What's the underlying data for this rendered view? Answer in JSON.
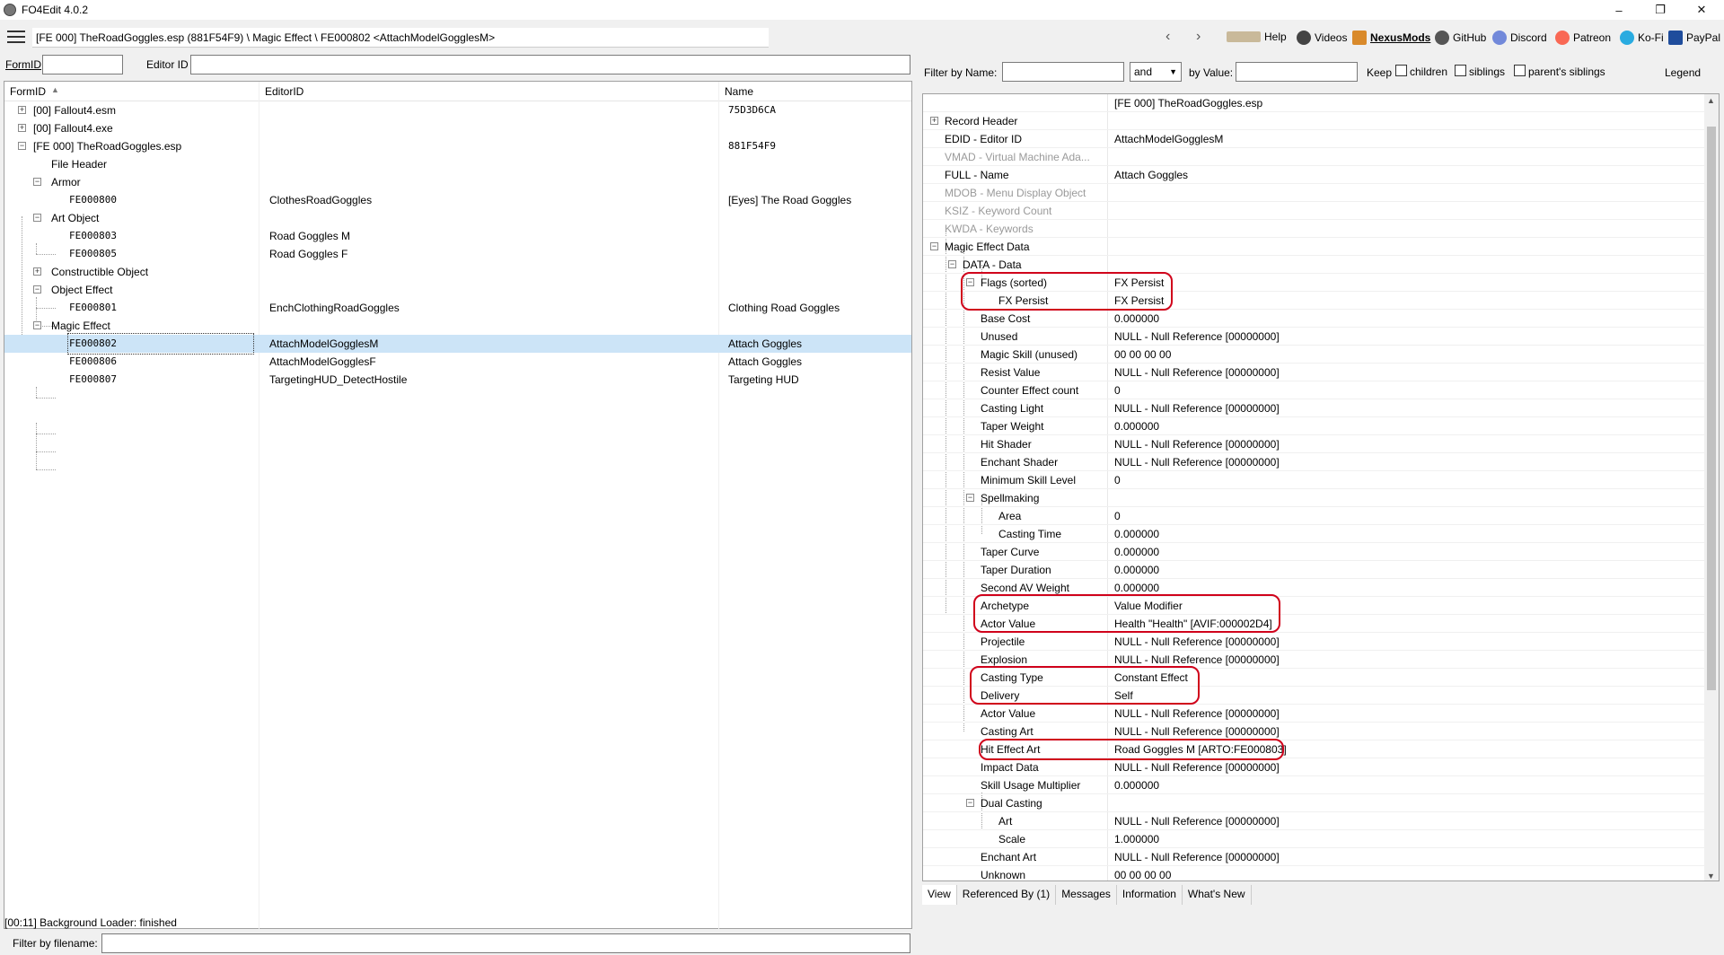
{
  "window": {
    "title": "FO4Edit 4.0.2"
  },
  "toolbar": {
    "path": "[FE 000] TheRoadGoggles.esp (881F54F9) \\ Magic Effect \\ FE000802 <AttachModelGogglesM>",
    "links": [
      "Help",
      "Videos",
      "NexusMods",
      "GitHub",
      "Discord",
      "Patreon",
      "Ko-Fi",
      "PayPal"
    ]
  },
  "left_filter": {
    "formid_label": "FormID",
    "editorid_label": "Editor ID"
  },
  "tree": {
    "columns": [
      "FormID",
      "EditorID",
      "Name"
    ],
    "rows": [
      {
        "formid": "[00] Fallout4.esm",
        "editorid": "",
        "name": "75D3D6CA"
      },
      {
        "formid": "[00] Fallout4.exe",
        "editorid": "",
        "name": ""
      },
      {
        "formid": "[FE 000] TheRoadGoggles.esp",
        "editorid": "",
        "name": "881F54F9"
      },
      {
        "formid": "File Header",
        "editorid": "",
        "name": ""
      },
      {
        "formid": "Armor",
        "editorid": "",
        "name": ""
      },
      {
        "formid": "FE000800",
        "editorid": "ClothesRoadGoggles",
        "name": "[Eyes] The Road Goggles"
      },
      {
        "formid": "Art Object",
        "editorid": "",
        "name": ""
      },
      {
        "formid": "FE000803",
        "editorid": "Road Goggles M",
        "name": ""
      },
      {
        "formid": "FE000805",
        "editorid": "Road Goggles F",
        "name": ""
      },
      {
        "formid": "Constructible Object",
        "editorid": "",
        "name": ""
      },
      {
        "formid": "Object Effect",
        "editorid": "",
        "name": ""
      },
      {
        "formid": "FE000801",
        "editorid": "EnchClothingRoadGoggles",
        "name": "Clothing Road Goggles"
      },
      {
        "formid": "Magic Effect",
        "editorid": "",
        "name": ""
      },
      {
        "formid": "FE000802",
        "editorid": "AttachModelGogglesM",
        "name": "Attach Goggles"
      },
      {
        "formid": "FE000806",
        "editorid": "AttachModelGogglesF",
        "name": "Attach Goggles"
      },
      {
        "formid": "FE000807",
        "editorid": "TargetingHUD_DetectHostile",
        "name": "Targeting HUD"
      }
    ]
  },
  "bottom_filter": {
    "label": "Filter by filename:"
  },
  "right_filter": {
    "by_name_label": "Filter by Name:",
    "and_value": "and",
    "by_value_label": "by Value:",
    "keep_label": "Keep",
    "children_label": "children",
    "siblings_label": "siblings",
    "parents_siblings_label": "parent's siblings",
    "legend_label": "Legend"
  },
  "record": {
    "header_value": "[FE 000] TheRoadGoggles.esp",
    "rows": [
      {
        "label": "Record Header",
        "value": ""
      },
      {
        "label": "EDID - Editor ID",
        "value": "AttachModelGogglesM"
      },
      {
        "label": "VMAD - Virtual Machine Ada...",
        "value": ""
      },
      {
        "label": "FULL - Name",
        "value": "Attach Goggles"
      },
      {
        "label": "MDOB - Menu Display Object",
        "value": ""
      },
      {
        "label": "KSIZ - Keyword Count",
        "value": ""
      },
      {
        "label": "KWDA - Keywords",
        "value": ""
      },
      {
        "label": "Magic Effect Data",
        "value": ""
      },
      {
        "label": "DATA - Data",
        "value": ""
      },
      {
        "label": "Flags (sorted)",
        "value": "FX Persist"
      },
      {
        "label": "FX Persist",
        "value": "FX Persist"
      },
      {
        "label": "Base Cost",
        "value": "0.000000"
      },
      {
        "label": "Unused",
        "value": "NULL - Null Reference [00000000]"
      },
      {
        "label": "Magic Skill (unused)",
        "value": "00 00 00 00"
      },
      {
        "label": "Resist Value",
        "value": "NULL - Null Reference [00000000]"
      },
      {
        "label": "Counter Effect count",
        "value": "0"
      },
      {
        "label": "Casting Light",
        "value": "NULL - Null Reference [00000000]"
      },
      {
        "label": "Taper Weight",
        "value": "0.000000"
      },
      {
        "label": "Hit Shader",
        "value": "NULL - Null Reference [00000000]"
      },
      {
        "label": "Enchant Shader",
        "value": "NULL - Null Reference [00000000]"
      },
      {
        "label": "Minimum Skill Level",
        "value": "0"
      },
      {
        "label": "Spellmaking",
        "value": ""
      },
      {
        "label": "Area",
        "value": "0"
      },
      {
        "label": "Casting Time",
        "value": "0.000000"
      },
      {
        "label": "Taper Curve",
        "value": "0.000000"
      },
      {
        "label": "Taper Duration",
        "value": "0.000000"
      },
      {
        "label": "Second AV Weight",
        "value": "0.000000"
      },
      {
        "label": "Archetype",
        "value": "Value Modifier"
      },
      {
        "label": "Actor Value",
        "value": "Health \"Health\" [AVIF:000002D4]"
      },
      {
        "label": "Projectile",
        "value": "NULL - Null Reference [00000000]"
      },
      {
        "label": "Explosion",
        "value": "NULL - Null Reference [00000000]"
      },
      {
        "label": "Casting Type",
        "value": "Constant Effect"
      },
      {
        "label": "Delivery",
        "value": "Self"
      },
      {
        "label": "Actor Value",
        "value": "NULL - Null Reference [00000000]"
      },
      {
        "label": "Casting Art",
        "value": "NULL - Null Reference [00000000]"
      },
      {
        "label": "Hit Effect Art",
        "value": "Road Goggles M [ARTO:FE000803]"
      },
      {
        "label": "Impact Data",
        "value": "NULL - Null Reference [00000000]"
      },
      {
        "label": "Skill Usage Multiplier",
        "value": "0.000000"
      },
      {
        "label": "Dual Casting",
        "value": ""
      },
      {
        "label": "Art",
        "value": "NULL - Null Reference [00000000]"
      },
      {
        "label": "Scale",
        "value": "1.000000"
      },
      {
        "label": "Enchant Art",
        "value": "NULL - Null Reference [00000000]"
      },
      {
        "label": "Unknown",
        "value": "00 00 00 00"
      }
    ]
  },
  "tabs": [
    "View",
    "Referenced By (1)",
    "Messages",
    "Information",
    "What's New"
  ],
  "status": "[00:11] Background Loader: finished"
}
